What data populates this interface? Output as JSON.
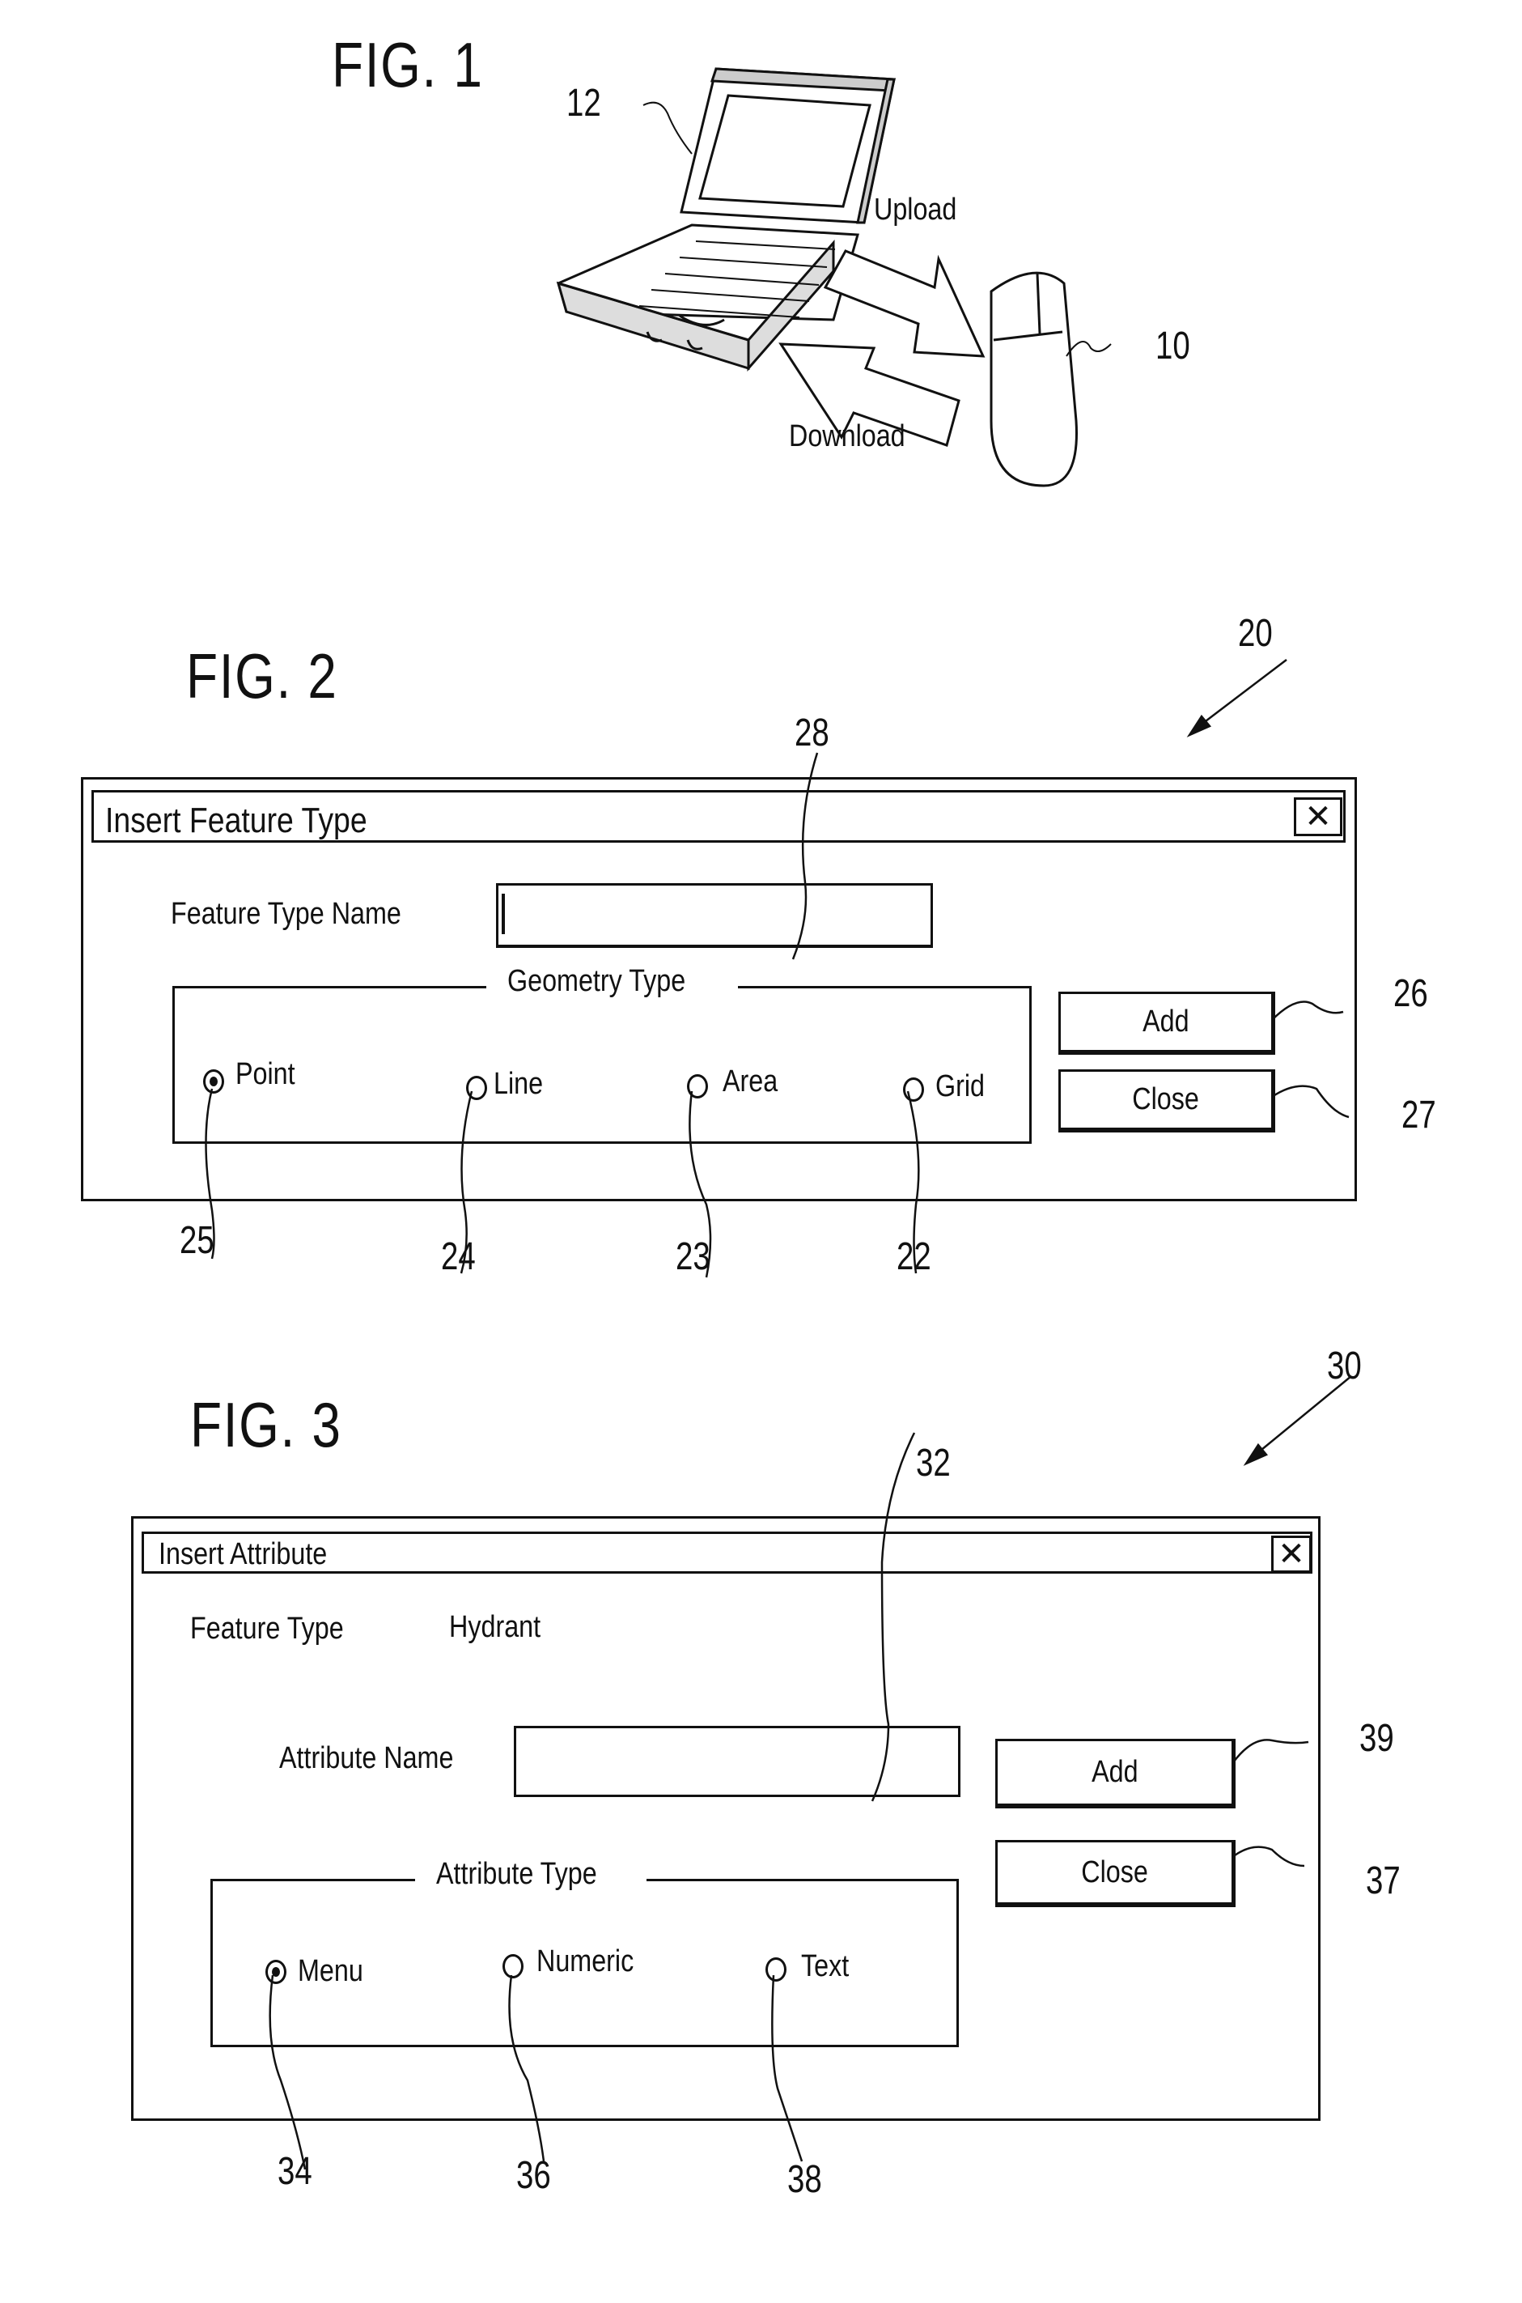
{
  "fig1": {
    "title": "FIG. 1",
    "ref_laptop": "12",
    "ref_mouse": "10",
    "upload_label": "Upload",
    "download_label": "Download"
  },
  "fig2": {
    "title": "FIG. 2",
    "ref_dialog": "20",
    "dialog_title": "Insert Feature Type",
    "close_icon_glyph": "✕",
    "feature_type_name_label": "Feature Type Name",
    "feature_type_name_value": "",
    "ref_input": "28",
    "group_label": "Geometry Type",
    "radios": [
      {
        "label": "Point",
        "selected": true,
        "ref": "25"
      },
      {
        "label": "Line",
        "selected": false,
        "ref": "24"
      },
      {
        "label": "Area",
        "selected": false,
        "ref": "23"
      },
      {
        "label": "Grid",
        "selected": false,
        "ref": "22"
      }
    ],
    "add_label": "Add",
    "ref_add": "26",
    "close_label": "Close",
    "ref_close": "27"
  },
  "fig3": {
    "title": "FIG. 3",
    "ref_dialog": "30",
    "dialog_title": "Insert Attribute",
    "close_icon_glyph": "✕",
    "feature_type_label": "Feature Type",
    "feature_type_value": "Hydrant",
    "attribute_name_label": "Attribute Name",
    "attribute_name_value": "",
    "ref_input": "32",
    "group_label": "Attribute Type",
    "radios": [
      {
        "label": "Menu",
        "selected": true,
        "ref": "34"
      },
      {
        "label": "Numeric",
        "selected": false,
        "ref": "36"
      },
      {
        "label": "Text",
        "selected": false,
        "ref": "38"
      }
    ],
    "add_label": "Add",
    "ref_add": "39",
    "close_label": "Close",
    "ref_close": "37"
  }
}
